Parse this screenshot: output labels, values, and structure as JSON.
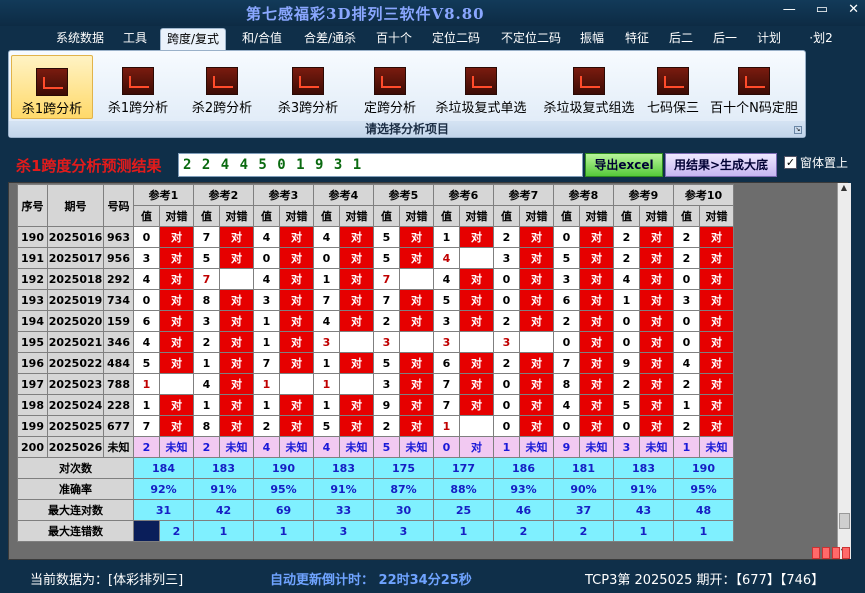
{
  "window": {
    "title": "第七感福彩3D排列三软件V8.80",
    "controls": [
      "—",
      "▭",
      "✕"
    ]
  },
  "menu": {
    "tabs": [
      "系统数据",
      "工具",
      "跨度/复式",
      "和/合值",
      "合差/通杀",
      "百十个",
      "定位二码",
      "不定位二码",
      "振幅",
      "特征",
      "后二",
      "后一",
      "计划",
      "·划2"
    ],
    "active": 2
  },
  "ribbon": {
    "buttons": [
      "杀1跨分析",
      "杀1跨分析",
      "杀2跨分析",
      "杀3跨分析",
      "定跨分析",
      "杀垃圾复式单选",
      "杀垃圾复式组选",
      "七码保三",
      "百十个N码定胆"
    ],
    "active": 0,
    "footer": "请选择分析项目"
  },
  "result": {
    "title": "杀1跨度分析预测结果",
    "value": "2 2 4 4 5 0 1 9 3 1",
    "excel_button": "导出excel",
    "generate_button": "用结果>生成大底",
    "on_top_label": "窗体置上",
    "on_top_checked": "✓"
  },
  "table": {
    "headers": {
      "seq": "序号",
      "period": "期号",
      "code": "号码",
      "refs": [
        "参考1",
        "参考2",
        "参考3",
        "参考4",
        "参考5",
        "参考6",
        "参考7",
        "参考8",
        "参考9",
        "参考10"
      ],
      "val": "值",
      "hit": "对错"
    },
    "rows": [
      {
        "seq": "190",
        "period": "2025016",
        "code": "963",
        "vals": [
          "0",
          "7",
          "4",
          "4",
          "5",
          "1",
          "2",
          "0",
          "2",
          "2"
        ],
        "hits": [
          "对",
          "对",
          "对",
          "对",
          "对",
          "对",
          "对",
          "对",
          "对",
          "对"
        ]
      },
      {
        "seq": "191",
        "period": "2025017",
        "code": "956",
        "vals": [
          "3",
          "5",
          "0",
          "0",
          "5",
          "4",
          "3",
          "5",
          "2",
          "2"
        ],
        "hits": [
          "对",
          "对",
          "对",
          "对",
          "对",
          "",
          "对",
          "对",
          "对",
          "对"
        ]
      },
      {
        "seq": "192",
        "period": "2025018",
        "code": "292",
        "vals": [
          "4",
          "7",
          "4",
          "1",
          "7",
          "4",
          "0",
          "3",
          "4",
          "0"
        ],
        "hits": [
          "对",
          "",
          "对",
          "对",
          "",
          "对",
          "对",
          "对",
          "对",
          "对"
        ]
      },
      {
        "seq": "193",
        "period": "2025019",
        "code": "734",
        "vals": [
          "0",
          "8",
          "3",
          "7",
          "7",
          "5",
          "0",
          "6",
          "1",
          "3"
        ],
        "hits": [
          "对",
          "对",
          "对",
          "对",
          "对",
          "对",
          "对",
          "对",
          "对",
          "对"
        ]
      },
      {
        "seq": "194",
        "period": "2025020",
        "code": "159",
        "vals": [
          "6",
          "3",
          "1",
          "4",
          "2",
          "3",
          "2",
          "2",
          "0",
          "0"
        ],
        "hits": [
          "对",
          "对",
          "对",
          "对",
          "对",
          "对",
          "对",
          "对",
          "对",
          "对"
        ]
      },
      {
        "seq": "195",
        "period": "2025021",
        "code": "346",
        "vals": [
          "4",
          "2",
          "1",
          "3",
          "3",
          "3",
          "3",
          "0",
          "0",
          "0"
        ],
        "hits": [
          "对",
          "对",
          "对",
          "",
          "",
          "",
          "",
          "对",
          "对",
          "对"
        ]
      },
      {
        "seq": "196",
        "period": "2025022",
        "code": "484",
        "vals": [
          "5",
          "1",
          "7",
          "1",
          "5",
          "6",
          "2",
          "7",
          "9",
          "4"
        ],
        "hits": [
          "对",
          "对",
          "对",
          "对",
          "对",
          "对",
          "对",
          "对",
          "对",
          "对"
        ]
      },
      {
        "seq": "197",
        "period": "2025023",
        "code": "788",
        "vals": [
          "1",
          "4",
          "1",
          "1",
          "3",
          "7",
          "0",
          "8",
          "2",
          "2"
        ],
        "hits": [
          "",
          "对",
          "",
          "",
          "对",
          "对",
          "对",
          "对",
          "对",
          "对"
        ]
      },
      {
        "seq": "198",
        "period": "2025024",
        "code": "228",
        "vals": [
          "1",
          "1",
          "1",
          "1",
          "9",
          "7",
          "0",
          "4",
          "5",
          "1"
        ],
        "hits": [
          "对",
          "对",
          "对",
          "对",
          "对",
          "对",
          "对",
          "对",
          "对",
          "对"
        ]
      },
      {
        "seq": "199",
        "period": "2025025",
        "code": "677",
        "vals": [
          "7",
          "8",
          "2",
          "5",
          "2",
          "1",
          "0",
          "0",
          "0",
          "2"
        ],
        "hits": [
          "对",
          "对",
          "对",
          "对",
          "对",
          "",
          "对",
          "对",
          "对",
          "对"
        ]
      },
      {
        "seq": "200",
        "period": "2025026",
        "code": "未知",
        "vals": [
          "2",
          "2",
          "4",
          "4",
          "5",
          "0",
          "1",
          "9",
          "3",
          "1"
        ],
        "hits": [
          "未知",
          "未知",
          "未知",
          "未知",
          "未知",
          "对",
          "未知",
          "未知",
          "未知",
          "未知"
        ]
      }
    ],
    "stats": [
      {
        "label": "对次数",
        "values": [
          "184",
          "183",
          "190",
          "183",
          "175",
          "177",
          "186",
          "181",
          "183",
          "190"
        ]
      },
      {
        "label": "准确率",
        "values": [
          "92%",
          "91%",
          "95%",
          "91%",
          "87%",
          "88%",
          "93%",
          "90%",
          "91%",
          "95%"
        ]
      },
      {
        "label": "最大连对数",
        "values": [
          "31",
          "42",
          "69",
          "33",
          "30",
          "25",
          "46",
          "37",
          "43",
          "48"
        ]
      },
      {
        "label": "最大连错数",
        "values": [
          "2",
          "1",
          "1",
          "3",
          "3",
          "1",
          "2",
          "2",
          "1",
          "1"
        ]
      }
    ]
  },
  "status": {
    "current": "当前数据为：[体彩排列三]",
    "countdown": "自动更新倒计时： 22时34分25秒",
    "draw": "TCP3第 2025025 期开：【677】【746】"
  }
}
